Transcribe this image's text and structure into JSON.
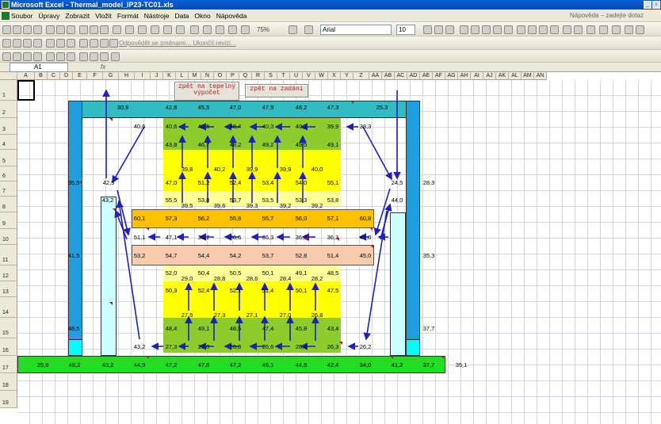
{
  "window": {
    "title": "Microsoft Excel - Thermal_model_IP23-TC01.xls"
  },
  "menu": {
    "items": [
      "Soubor",
      "Úpravy",
      "Zobrazit",
      "Vložit",
      "Formát",
      "Nástroje",
      "Data",
      "Okno",
      "Nápověda"
    ],
    "help_placeholder": "Nápověda – zadejte dotaz"
  },
  "toolbar": {
    "zoom": "75%",
    "font_name": "Arial",
    "font_size": "10",
    "review_label": "Odpovědět se změnami... Ukončit revizi..."
  },
  "formula_bar": {
    "name_box": "A1",
    "fx_label": "fx"
  },
  "columns": [
    "A",
    "B",
    "C",
    "D",
    "E",
    "F",
    "G",
    "H",
    "I",
    "J",
    "K",
    "L",
    "M",
    "N",
    "O",
    "P",
    "Q",
    "R",
    "S",
    "T",
    "U",
    "V",
    "W",
    "X",
    "Y",
    "Z",
    "AA",
    "AB",
    "AC",
    "AD",
    "AE",
    "AF",
    "AG",
    "AH",
    "AI",
    "AJ",
    "AK",
    "AL",
    "AM",
    "AN"
  ],
  "rows": [
    "1",
    "2",
    "3",
    "4",
    "5",
    "6",
    "7",
    "8",
    "9",
    "10",
    "11",
    "12",
    "13",
    "14",
    "15",
    "16",
    "17",
    "18",
    "19"
  ],
  "buttons": {
    "thermal_calc": "zpět na tepelný výpočet",
    "assignment": "zpět na zadání"
  },
  "cells": {
    "r2": [
      "30,9",
      "42,8",
      "45,5",
      "47,0",
      "47,9",
      "48,2",
      "47,3",
      "25,3"
    ],
    "r3": [
      "40,6",
      "40,6",
      "40,5",
      "48,4",
      "40,3",
      "40,1",
      "39,9",
      "38,3"
    ],
    "r4": [
      "43,8",
      "46,7",
      "48,2",
      "49,2",
      "49,5",
      "49,1"
    ],
    "r5": [
      "39,8",
      "40,2",
      "39,9",
      "39,9",
      "40,0"
    ],
    "r6": [
      "35,5",
      "42,5",
      "47,0",
      "51,2",
      "52,4",
      "53,4",
      "54,0",
      "55,1",
      "24,5",
      "28,3"
    ],
    "r7": [
      "43,2",
      "55,5",
      "53,8",
      "53,7",
      "53,5",
      "53,3",
      "53,8",
      "44,0"
    ],
    "r7b": [
      "39,5",
      "39,6",
      "39,3",
      "39,2",
      "39,2"
    ],
    "r8": [
      "60,1",
      "57,3",
      "56,2",
      "55,8",
      "55,7",
      "56,0",
      "57,1",
      "60,8"
    ],
    "r9": [
      "51,1",
      "47,1",
      "36,2",
      "36,6",
      "36,3",
      "36,3",
      "36,3",
      "47,0"
    ],
    "r10": [
      "41,5",
      "53,2",
      "54,7",
      "54,4",
      "54,2",
      "53,7",
      "52,8",
      "51,4",
      "45,0",
      "35,3"
    ],
    "r11": [
      "52,0",
      "50,4",
      "50,5",
      "50,1",
      "49,1",
      "48,5"
    ],
    "r11b": [
      "29,0",
      "28,8",
      "28,6",
      "28,4",
      "28,2"
    ],
    "r12": [
      "50,3",
      "52,4",
      "52,1",
      "51,4",
      "50,1",
      "47,5"
    ],
    "r13": [
      "27,5",
      "27,3",
      "27,1",
      "27,0",
      "26,8"
    ],
    "r14": [
      "48,5",
      "48,4",
      "49,1",
      "48,5",
      "47,4",
      "45,8",
      "43,4",
      "37,7"
    ],
    "r15": [
      "43,2",
      "27,3",
      "27,0",
      "26,8",
      "26,6",
      "26,4",
      "26,3",
      "26,2"
    ],
    "r16": [
      "25,9",
      "48,2",
      "43,2",
      "44,9",
      "47,2",
      "47,6",
      "47,2",
      "46,1",
      "44,5",
      "42,4",
      "34,0",
      "41,2",
      "37,7",
      "35,1"
    ]
  },
  "colors": {
    "teal": "#33bbc4",
    "blue": "#1f9fe0",
    "cyan_light": "#ccffff",
    "cyan": "#00ffff",
    "green_dark": "#8ccc2c",
    "yellow": "#ffff00",
    "yellow_light": "#ffff99",
    "orange": "#ffc000",
    "peach": "#f8cbad",
    "green_bright": "#22dd22",
    "arrow": "#1f1fc0"
  }
}
